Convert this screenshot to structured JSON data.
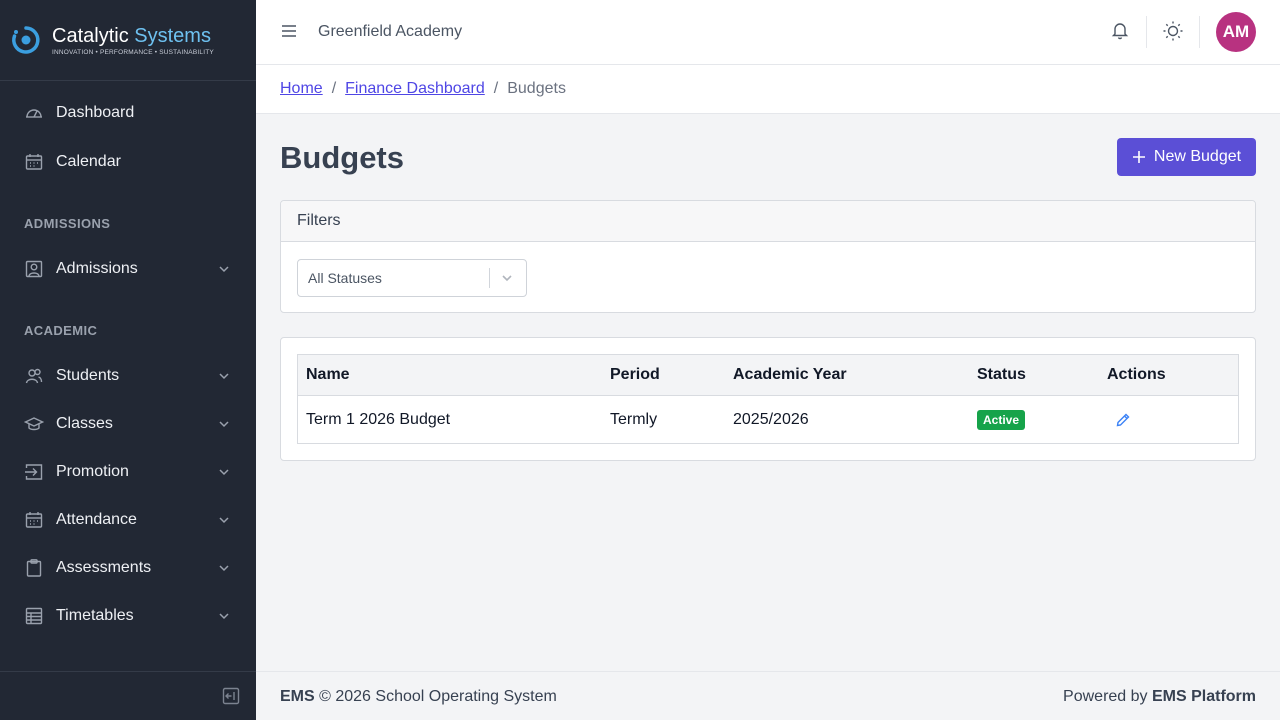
{
  "brand": {
    "name_part1": "Catalytic",
    "name_part2": "Systems",
    "tagline": "INNOVATION • PERFORMANCE • SUSTAINABILITY",
    "accent_color": "#6ec1f0"
  },
  "sidebar": {
    "items": [
      {
        "label": "Dashboard",
        "icon": "gauge-icon"
      },
      {
        "label": "Calendar",
        "icon": "calendar-icon"
      }
    ],
    "sections": [
      {
        "label": "ADMISSIONS",
        "items": [
          {
            "label": "Admissions",
            "icon": "user-frame-icon"
          }
        ]
      },
      {
        "label": "ACADEMIC",
        "items": [
          {
            "label": "Students",
            "icon": "users-icon"
          },
          {
            "label": "Classes",
            "icon": "graduation-cap-icon"
          },
          {
            "label": "Promotion",
            "icon": "arrow-right-icon"
          },
          {
            "label": "Attendance",
            "icon": "calendar-icon"
          },
          {
            "label": "Assessments",
            "icon": "clipboard-icon"
          },
          {
            "label": "Timetables",
            "icon": "table-icon"
          }
        ]
      }
    ]
  },
  "topbar": {
    "school_name": "Greenfield Academy",
    "avatar_initials": "AM",
    "avatar_color": "#b83280"
  },
  "breadcrumb": {
    "home": "Home",
    "parent": "Finance Dashboard",
    "current": "Budgets",
    "separator": "/"
  },
  "page": {
    "title": "Budgets",
    "new_button_label": "New Budget"
  },
  "filters": {
    "header": "Filters",
    "status_select_value": "All Statuses"
  },
  "table": {
    "columns": [
      "Name",
      "Period",
      "Academic Year",
      "Status",
      "Actions"
    ],
    "rows": [
      {
        "name": "Term 1 2026 Budget",
        "period": "Termly",
        "academic_year": "2025/2026",
        "status": "Active"
      }
    ],
    "status_color": "#16a34a"
  },
  "footer": {
    "left_bold": "EMS",
    "left_text": " © 2026 School Operating System",
    "right_text": "Powered by ",
    "right_bold": "EMS Platform"
  }
}
